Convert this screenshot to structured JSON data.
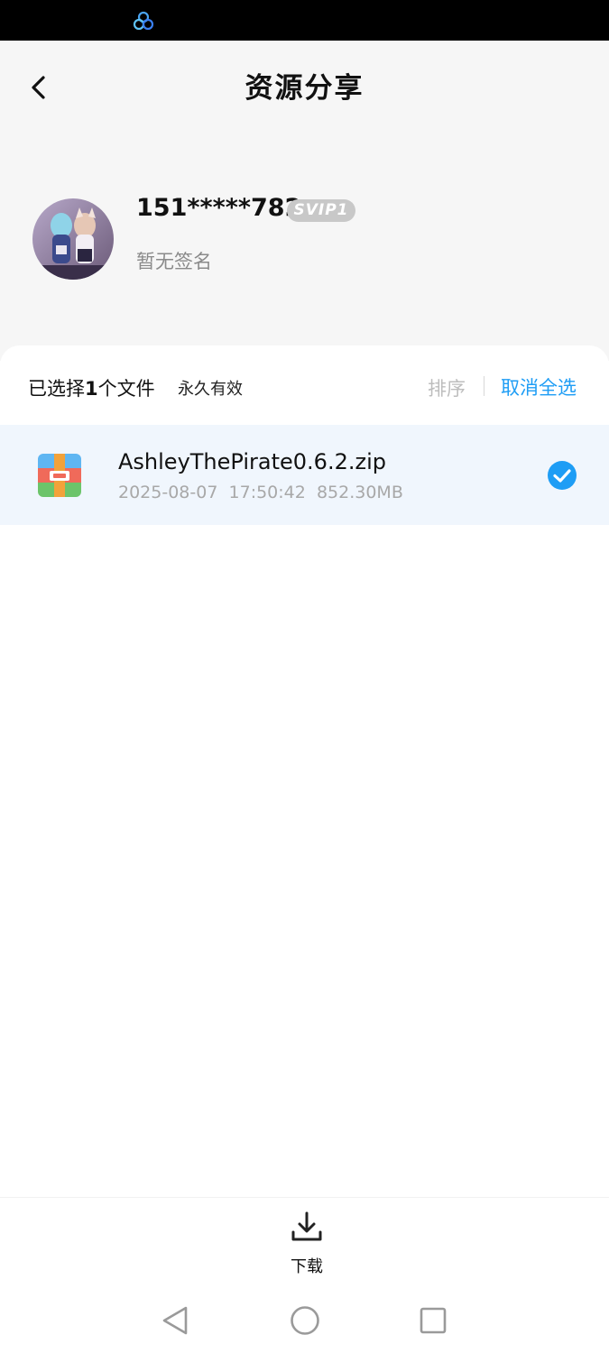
{
  "status_bar": {
    "app_icon": "cloud-rings-icon"
  },
  "header": {
    "title": "资源分享",
    "back_icon": "chevron-left-icon"
  },
  "profile": {
    "username": "151*****782",
    "vip_badge": "SVIP1",
    "signature": "暂无签名"
  },
  "selection_bar": {
    "selected_prefix": "已选择",
    "selected_count": "1",
    "selected_suffix": "个文件",
    "validity": "永久有效",
    "sort_label": "排序",
    "deselect_all_label": "取消全选"
  },
  "files": [
    {
      "name": "AshleyThePirate0.6.2.zip",
      "date": "2025-08-07",
      "time": "17:50:42",
      "size": "852.30MB",
      "icon": "zip-archive-icon",
      "selected": true
    }
  ],
  "bottom_bar": {
    "download_label": "下载",
    "download_icon": "download-icon"
  },
  "colors": {
    "accent": "#1e9df5",
    "selected_row_bg": "#f0f6fd",
    "header_bg": "#f6f6f6"
  }
}
